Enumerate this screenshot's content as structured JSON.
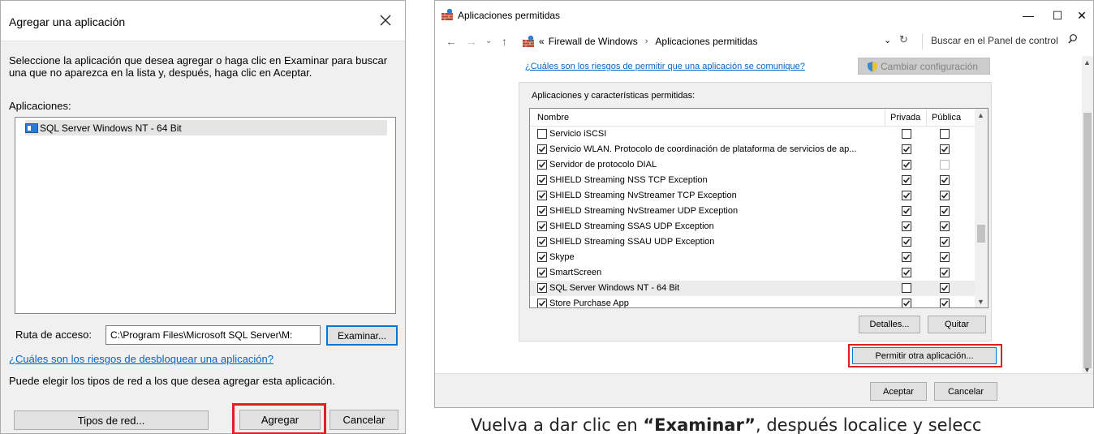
{
  "add_app_dialog": {
    "title": "Agregar una aplicación",
    "instructions": "Seleccione la aplicación que desea agregar o haga clic en Examinar para buscar una que no aparezca en la lista y, después, haga clic en Aceptar.",
    "apps_label": "Aplicaciones:",
    "apps": [
      {
        "label": "SQL Server Windows NT - 64 Bit"
      }
    ],
    "path_label": "Ruta de acceso:",
    "path_value": "C:\\Program Files\\Microsoft SQL Server\\M:",
    "browse_label": "Examinar...",
    "risk_link": "¿Cuáles son los riesgos de desbloquear una aplicación?",
    "network_info": "Puede elegir los tipos de red a los que desea agregar esta aplicación.",
    "network_types_label": "Tipos de red...",
    "add_label": "Agregar",
    "cancel_label": "Cancelar"
  },
  "allowed_apps_window": {
    "title": "Aplicaciones permitidas",
    "window_controls": {
      "minimize": "—",
      "maximize": "☐",
      "close": "✕"
    },
    "breadcrumb": {
      "prefix": "«",
      "items": [
        "Firewall de Windows",
        "Aplicaciones permitidas"
      ],
      "separator": "›"
    },
    "search_placeholder": "Buscar en el Panel de control",
    "risk_link": "¿Cuáles son los riesgos de permitir que una aplicación se comunique?",
    "change_settings_label": "Cambiar configuración",
    "group_label": "Aplicaciones y características permitidas:",
    "columns": {
      "name": "Nombre",
      "private": "Privada",
      "public": "Pública"
    },
    "rows": [
      {
        "name": "Servicio iSCSI",
        "enabled": false,
        "private": false,
        "public": false
      },
      {
        "name": "Servicio WLAN. Protocolo de coordinación de plataforma de servicios de ap...",
        "enabled": true,
        "private": true,
        "public": true
      },
      {
        "name": "Servidor de protocolo DIAL",
        "enabled": true,
        "private": true,
        "public": false
      },
      {
        "name": "SHIELD Streaming NSS TCP Exception",
        "enabled": true,
        "private": true,
        "public": true
      },
      {
        "name": "SHIELD Streaming NvStreamer TCP Exception",
        "enabled": true,
        "private": true,
        "public": true
      },
      {
        "name": "SHIELD Streaming NvStreamer UDP Exception",
        "enabled": true,
        "private": true,
        "public": true
      },
      {
        "name": "SHIELD Streaming SSAS UDP Exception",
        "enabled": true,
        "private": true,
        "public": true
      },
      {
        "name": "SHIELD Streaming SSAU UDP Exception",
        "enabled": true,
        "private": true,
        "public": true
      },
      {
        "name": "Skype",
        "enabled": true,
        "private": true,
        "public": true
      },
      {
        "name": "SmartScreen",
        "enabled": true,
        "private": true,
        "public": true
      },
      {
        "name": "SQL Server Windows NT - 64 Bit",
        "enabled": true,
        "private": false,
        "public": true,
        "selected": true
      },
      {
        "name": "Store Purchase App",
        "enabled": true,
        "private": true,
        "public": true
      }
    ],
    "details_label": "Detalles...",
    "remove_label": "Quitar",
    "allow_another_label": "Permitir otra aplicación...",
    "ok_label": "Aceptar",
    "cancel_label": "Cancelar"
  },
  "document_text": {
    "before": "Vuelva a dar clic en ",
    "bold": "“Examinar”",
    "after": ", después localice y selecc"
  },
  "colors": {
    "accent": "#0078d7",
    "highlight": "#e02020",
    "link": "#0066cc"
  }
}
